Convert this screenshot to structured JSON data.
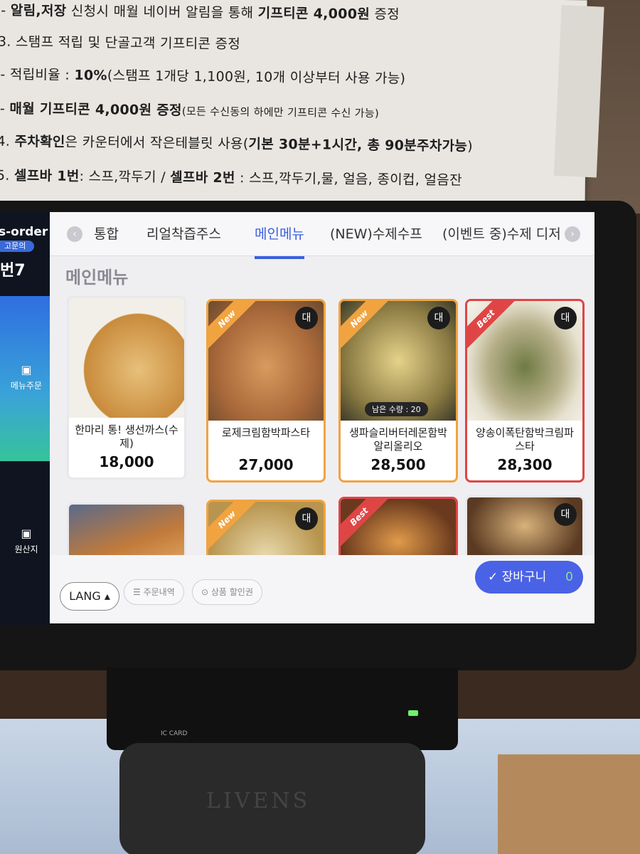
{
  "notice": {
    "lines": [
      {
        "pre": "- ",
        "bold1": "알림,저장",
        "mid": " 신청시 매월 네이버 알림을 통해 ",
        "bold2": "기프티콘 4,000원",
        "post": " 증정"
      },
      {
        "pre": "3. 스탬프 적립 및 단골고객 기프티콘 증정",
        "bold1": "",
        "mid": "",
        "bold2": "",
        "post": ""
      },
      {
        "pre": "- 적립비율 : ",
        "bold1": "10%",
        "mid": "(스탬프 1개당 1,100원, 10개 이상부터 사용 가능)",
        "bold2": "",
        "post": ""
      },
      {
        "pre": "- ",
        "bold1": "매월 기프티콘 4,000원 증정",
        "mid": "(모든 수신동의 하에만 기프티콘 수신 가능)",
        "bold2": "",
        "post": ""
      },
      {
        "pre": "4. ",
        "bold1": "주차확인",
        "mid": "은 카운터에서 작은테블릿 사용(",
        "bold2": "기본 30분+1시간, 총 90분주차가능",
        "post": ")"
      },
      {
        "pre": "5. ",
        "bold1": "셀프바 1번",
        "mid": ": 스프,깍두기 / ",
        "bold2": "셀프바 2번",
        "post": " : 스프,깍두기,물, 얼음, 종이컵, 얼음잔"
      }
    ]
  },
  "sidebar": {
    "brand": "s-order",
    "brand_sub": "고문의",
    "table": "번7",
    "items": [
      {
        "icon": "clipboard-icon",
        "glyph": "▣",
        "label": "메뉴주문"
      },
      {
        "icon": "clipboard-icon",
        "glyph": "▣",
        "label": "원산지"
      }
    ]
  },
  "tabs": {
    "prev_glyph": "‹",
    "next_glyph": "›",
    "items": [
      "통합",
      "리얼착즙주스",
      "메인메뉴",
      "(NEW)수제수프",
      "(이벤트 중)수제 디저"
    ],
    "active_index": 2
  },
  "section_title": "메인메뉴",
  "menu": [
    {
      "name": "한마리 통! 생선까스(수제)",
      "price": "18,000",
      "tag": "",
      "size": "",
      "stock": "",
      "color1": "#c98b3c",
      "color2": "#e7c07a"
    },
    {
      "name": "로제크림함박파스타",
      "price": "27,000",
      "tag": "New",
      "size": "대",
      "stock": "",
      "color1": "#a8683a",
      "color2": "#d99a5e"
    },
    {
      "name": "생파슬리버터레몬함박알리올리오",
      "price": "28,500",
      "tag": "New",
      "size": "대",
      "stock": "남은 수량 : 20",
      "color1": "#8a7a42",
      "color2": "#e5d28a"
    },
    {
      "name": "양송이폭탄함박크림파스타",
      "price": "28,300",
      "tag": "Best",
      "size": "대",
      "stock": "",
      "color1": "#6f7a44",
      "color2": "#e6e1cf"
    },
    {
      "name": "",
      "price": "",
      "tag": "",
      "size": "",
      "stock": "",
      "color1": "#c27a3a",
      "color2": "#e8b16a"
    },
    {
      "name": "",
      "price": "",
      "tag": "New",
      "size": "대",
      "stock": "",
      "color1": "#b8954e",
      "color2": "#eadcb0"
    },
    {
      "name": "",
      "price": "",
      "tag": "Best",
      "size": "",
      "stock": "",
      "color1": "#6b3a1e",
      "color2": "#e09a4a"
    },
    {
      "name": "",
      "price": "",
      "tag": "",
      "size": "대",
      "stock": "",
      "color1": "#5a3a22",
      "color2": "#d8b27a"
    }
  ],
  "bottom": {
    "lang": "LANG ▴",
    "order_history": "주문내역",
    "coupon": "상품 할인권",
    "cart": "장바구니",
    "cart_count": "0"
  },
  "hardware": {
    "ic_card": "IC CARD",
    "cover_brand": "LIVENS"
  },
  "colors": {
    "accent": "#3a5fe0",
    "new": "#f1a340",
    "best": "#e04545",
    "cart": "#4a62e6"
  }
}
